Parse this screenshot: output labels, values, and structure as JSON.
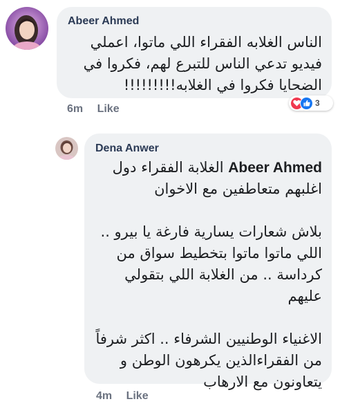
{
  "comments": [
    {
      "author": "Abeer Ahmed",
      "lines": [
        "الناس الغلابه الفقراء اللي ماتوا، اعملي",
        "فيديو تدعي الناس للتبرع لهم، فكروا في",
        "الضحايا فكروا في الغلابه!!!!!!!!!"
      ],
      "time": "6m",
      "like_label": "Like",
      "reactions": {
        "icons": [
          "love-reaction",
          "like-reaction"
        ],
        "count": "3",
        "colors": {
          "love": "#f0384f",
          "like": "#1877f2"
        }
      }
    }
  ],
  "reply": {
    "author": "Dena Anwer",
    "mention": "Abeer Ahmed",
    "first_line_rest": " الغلابة الفقراء دول",
    "lines_block1": [
      "اغلبهم متعاطفين مع الاخوان"
    ],
    "lines_block2": [
      "بلاش شعارات يسارية فارغة يا بيرو ..",
      "اللي ماتوا ماتوا بتخطيط سواق من",
      "كرداسة .. من الغلابة اللي بتقولي",
      "عليهم"
    ],
    "lines_block3": [
      "الاغنياء الوطنيين الشرفاء .. اكثر شرفاً",
      "من الفقراءالذين يكرهون الوطن و",
      "يتعاونون مع الارهاب"
    ],
    "time": "4m",
    "like_label": "Like"
  },
  "colors": {
    "bubble": "#eff1f3",
    "author": "#2b3a55",
    "meta": "#6b7280"
  }
}
